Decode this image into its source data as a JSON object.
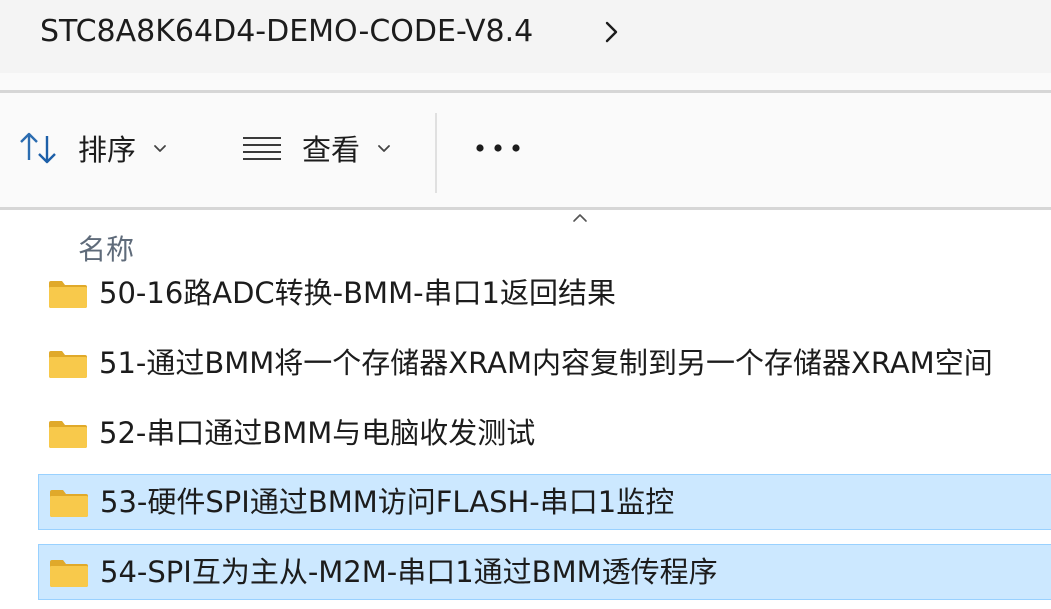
{
  "breadcrumb": {
    "current_folder": "STC8A8K64D4-DEMO-CODE-V8.4",
    "chevron_icon": "chevron-right-icon"
  },
  "toolbar": {
    "sort_label": "排序",
    "view_label": "查看",
    "sort_icon": "sort-icon",
    "view_icon": "view-list-icon",
    "more_icon": "more-options-icon"
  },
  "file_list": {
    "column_header": "名称",
    "sort_direction": "ascending",
    "items": [
      {
        "name": "50-16路ADC转换-BMM-串口1返回结果",
        "type": "folder",
        "selected": false
      },
      {
        "name": "51-通过BMM将一个存储器XRAM内容复制到另一个存储器XRAM空间",
        "type": "folder",
        "selected": false
      },
      {
        "name": "52-串口通过BMM与电脑收发测试",
        "type": "folder",
        "selected": false
      },
      {
        "name": "53-硬件SPI通过BMM访问FLASH-串口1监控",
        "type": "folder",
        "selected": true
      },
      {
        "name": "54-SPI互为主从-M2M-串口1通过BMM透传程序",
        "type": "folder",
        "selected": true
      }
    ]
  },
  "colors": {
    "selection_bg": "#cce8ff",
    "selection_border": "#99d1ff",
    "folder_yellow": "#f8c94b",
    "folder_yellow_dark": "#e0a92a"
  }
}
